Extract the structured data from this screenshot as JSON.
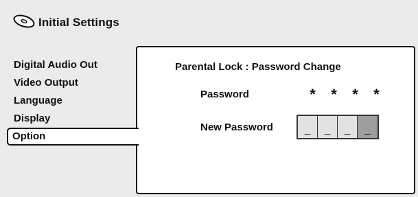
{
  "header": {
    "title": "Initial Settings",
    "icon": "disc-icon"
  },
  "menu": {
    "items": [
      {
        "label": "Digital Audio Out"
      },
      {
        "label": "Video Output"
      },
      {
        "label": "Language"
      },
      {
        "label": "Display"
      },
      {
        "label": "Option",
        "selected": true
      }
    ]
  },
  "panel": {
    "title": "Parental Lock : Password Change",
    "password_label": "Password",
    "password_mask": [
      "*",
      "*",
      "*",
      "*"
    ],
    "new_password_label": "New Password",
    "new_password_digits": [
      "_",
      "_",
      "_",
      "_"
    ],
    "active_digit_index": 3
  }
}
